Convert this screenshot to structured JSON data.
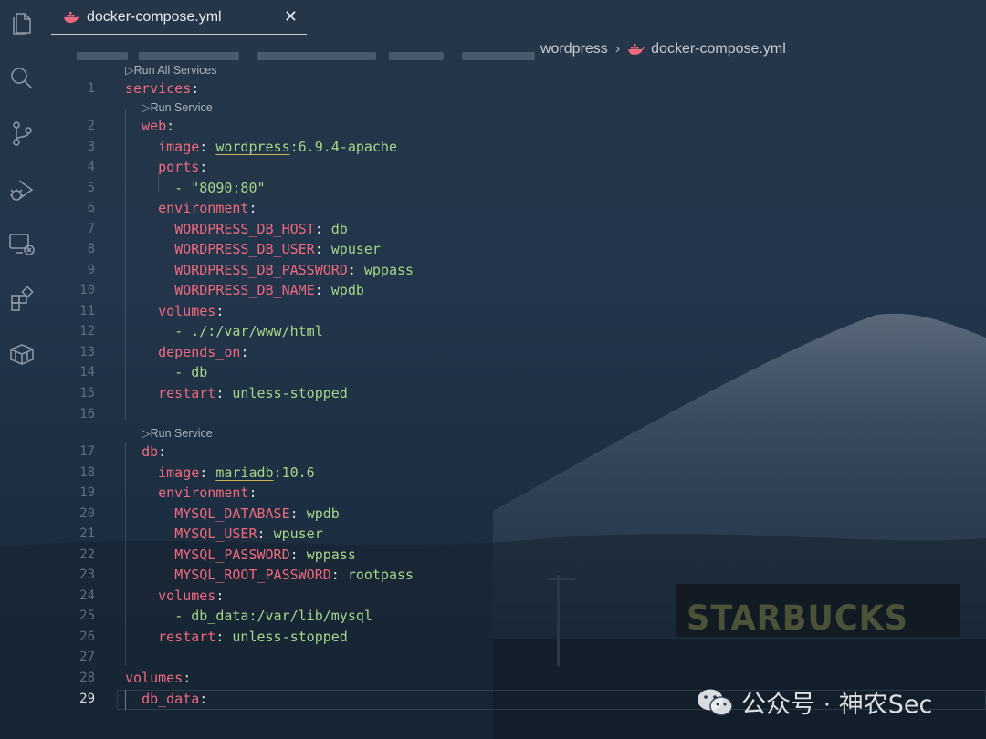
{
  "tab": {
    "title": "docker-compose.yml",
    "close_icon": "✕"
  },
  "breadcrumb": {
    "folder": "wordpress",
    "separator": "›",
    "file": "docker-compose.yml"
  },
  "codelens": {
    "run_all": "Run All Services",
    "run_service": "Run Service"
  },
  "code": {
    "l1": "services",
    "l2": "web",
    "l3": [
      "image",
      "wordpress",
      ":6.9.4-apache"
    ],
    "l4": "ports",
    "l5": "- \"8090:80\"",
    "l6": "environment",
    "l7": [
      "WORDPRESS_DB_HOST",
      "db"
    ],
    "l8": [
      "WORDPRESS_DB_USER",
      "wpuser"
    ],
    "l9": [
      "WORDPRESS_DB_PASSWORD",
      "wppass"
    ],
    "l10": [
      "WORDPRESS_DB_NAME",
      "wpdb"
    ],
    "l11": "volumes",
    "l12": "- ./:/var/www/html",
    "l13": "depends_on",
    "l14": "- db",
    "l15": [
      "restart",
      "unless-stopped"
    ],
    "l17": "db",
    "l18": [
      "image",
      "mariadb",
      ":10.6"
    ],
    "l19": "environment",
    "l20": [
      "MYSQL_DATABASE",
      "wpdb"
    ],
    "l21": [
      "MYSQL_USER",
      "wpuser"
    ],
    "l22": [
      "MYSQL_PASSWORD",
      "wppass"
    ],
    "l23": [
      "MYSQL_ROOT_PASSWORD",
      "rootpass"
    ],
    "l24": "volumes",
    "l25": "- db_data:/var/lib/mysql",
    "l26": [
      "restart",
      "unless-stopped"
    ],
    "l28": "volumes",
    "l29": "db_data"
  },
  "line_numbers": [
    "1",
    "2",
    "3",
    "4",
    "5",
    "6",
    "7",
    "8",
    "9",
    "10",
    "11",
    "12",
    "13",
    "14",
    "15",
    "16",
    "17",
    "18",
    "19",
    "20",
    "21",
    "22",
    "23",
    "24",
    "25",
    "26",
    "27",
    "28",
    "29"
  ],
  "background": {
    "sign_text": "STARBUCKS"
  },
  "watermark": {
    "text": "公众号 · 神农Sec"
  },
  "colors": {
    "key": "#f0697e",
    "value": "#a9d489",
    "background": "#1b2a3b"
  }
}
